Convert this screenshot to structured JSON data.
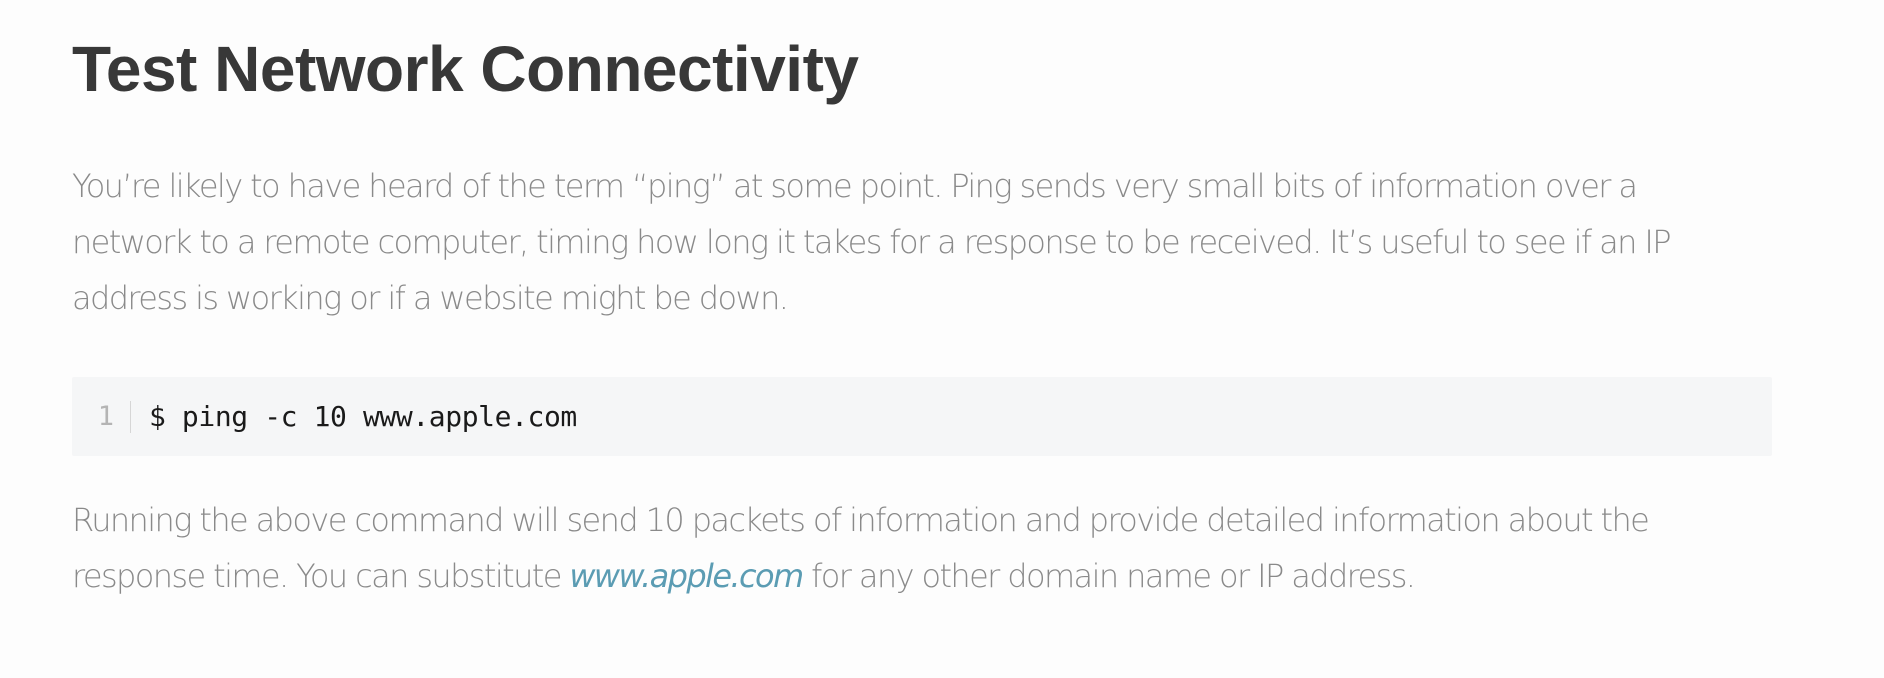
{
  "article": {
    "title": "Test Network Connectivity",
    "paragraph1": {
      "lines": [
        "You’re likely to have heard of the term “ping” at some point. Ping sends very small bits of information over a",
        "network to a remote computer, timing how long it takes for a response to be received. It’s useful to see if an IP",
        "address is working or if a website might be down."
      ]
    },
    "code": {
      "line_number": "1",
      "command": "$ ping -c 10 www.apple.com"
    },
    "paragraph2": {
      "line1": "Running the above command will send 10 packets of information and provide detailed information about the",
      "line2_before": "response time. You can substitute ",
      "link_text": "www.apple.com",
      "line2_after": " for any other domain name or IP address."
    },
    "colors": {
      "heading": "#383838",
      "body_text": "#8a8a8a",
      "link": "#5b9cb3",
      "code_background": "#f5f6f7"
    }
  }
}
